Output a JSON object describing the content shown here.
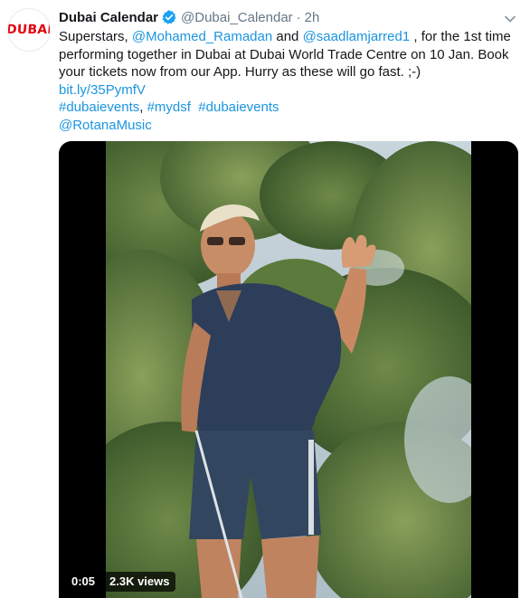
{
  "account": {
    "display_name": "Dubai Calendar",
    "handle": "@Dubai_Calendar",
    "separator": "·",
    "time": "2h",
    "avatar_text": "DUBAI",
    "verified": true
  },
  "tweet": {
    "text_1": "Superstars, ",
    "mention_1": "@Mohamed_Ramadan",
    "text_2": " and ",
    "mention_2": "@saadlamjarred1",
    "text_3": "  , for the 1st time performing together in Dubai at Dubai World Trade Centre on 10 Jan. Book your tickets now from our App. Hurry as these will go fast. ;-)",
    "short_link": "bit.ly/35PymfV",
    "hashtag_1": "#dubaievents",
    "hashtag_sep": ", ",
    "hashtag_2": "#mydsf",
    "hashtag_3": "#dubaievents",
    "mention_3": "@RotanaMusic"
  },
  "video": {
    "elapsed": "0:05",
    "views": "2.3K views"
  },
  "colors": {
    "link": "#1b95e0",
    "verified": "#1da1f2",
    "text": "#14171a",
    "muted": "#657786",
    "brand_red": "#e30613"
  },
  "icons": [
    "verified-badge-icon",
    "caret-down-icon"
  ]
}
